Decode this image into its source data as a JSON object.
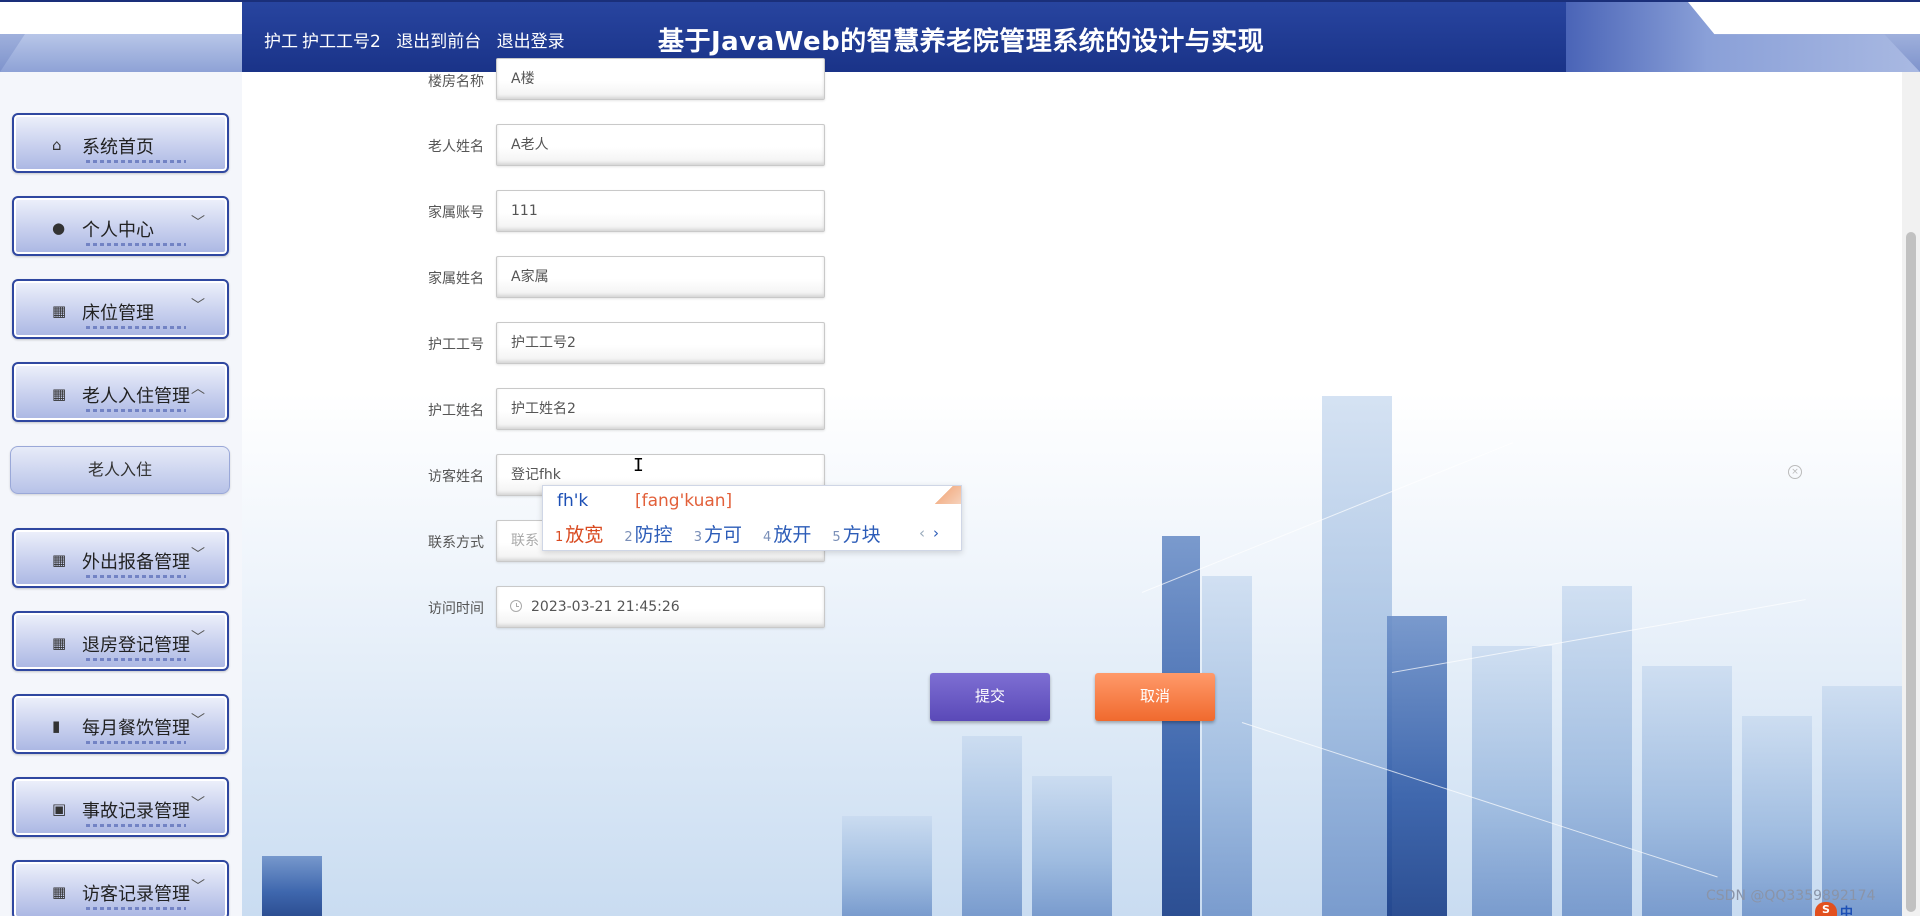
{
  "header": {
    "user_role": "护工",
    "user_name": "护工工号2",
    "back_to_front": "退出到前台",
    "logout": "退出登录",
    "site_title": "基于JavaWeb的智慧养老院管理系统的设计与实现"
  },
  "sidebar": {
    "items": [
      {
        "label": "系统首页",
        "icon": "home-icon"
      },
      {
        "label": "个人中心",
        "icon": "person-icon",
        "chevron": "﹀"
      },
      {
        "label": "床位管理",
        "icon": "grid-icon",
        "chevron": "﹀"
      },
      {
        "label": "老人入住管理",
        "icon": "grid-icon",
        "chevron": "︿"
      },
      {
        "label": "外出报备管理",
        "icon": "grid-icon",
        "chevron": "﹀"
      },
      {
        "label": "退房登记管理",
        "icon": "grid-icon",
        "chevron": "﹀"
      },
      {
        "label": "每月餐饮管理",
        "icon": "bar-chart-icon",
        "chevron": "﹀"
      },
      {
        "label": "事故记录管理",
        "icon": "clipboard-icon",
        "chevron": "﹀"
      },
      {
        "label": "访客记录管理",
        "icon": "grid-icon",
        "chevron": "﹀"
      }
    ],
    "sub_item": "老人入住"
  },
  "form": {
    "fields": [
      {
        "label": "楼房名称",
        "value": "A楼"
      },
      {
        "label": "老人姓名",
        "value": "A老人"
      },
      {
        "label": "家属账号",
        "value": "111"
      },
      {
        "label": "家属姓名",
        "value": "A家属"
      },
      {
        "label": "护工工号",
        "value": "护工工号2"
      },
      {
        "label": "护工姓名",
        "value": "护工姓名2"
      },
      {
        "label": "访客姓名",
        "value": "登记fhk"
      },
      {
        "label": "联系方式",
        "placeholder": "联系"
      },
      {
        "label": "访问时间",
        "value": "2023-03-21 21:45:26"
      }
    ],
    "submit_label": "提交",
    "cancel_label": "取消"
  },
  "ime": {
    "pinyin": "fh'k",
    "hint": "[fang'kuan]",
    "candidates": [
      {
        "num": "1",
        "text": "放宽"
      },
      {
        "num": "2",
        "text": "防控"
      },
      {
        "num": "3",
        "text": "方可"
      },
      {
        "num": "4",
        "text": "放开"
      },
      {
        "num": "5",
        "text": "方块"
      }
    ],
    "prev": "‹",
    "next": "›"
  },
  "watermark": "CSDN @QQ3359892174",
  "colors": {
    "header_blue": "#1a3388",
    "submit_purple": "#5a49b8",
    "cancel_orange": "#f06a2e",
    "ime_highlight": "#d94a20"
  }
}
